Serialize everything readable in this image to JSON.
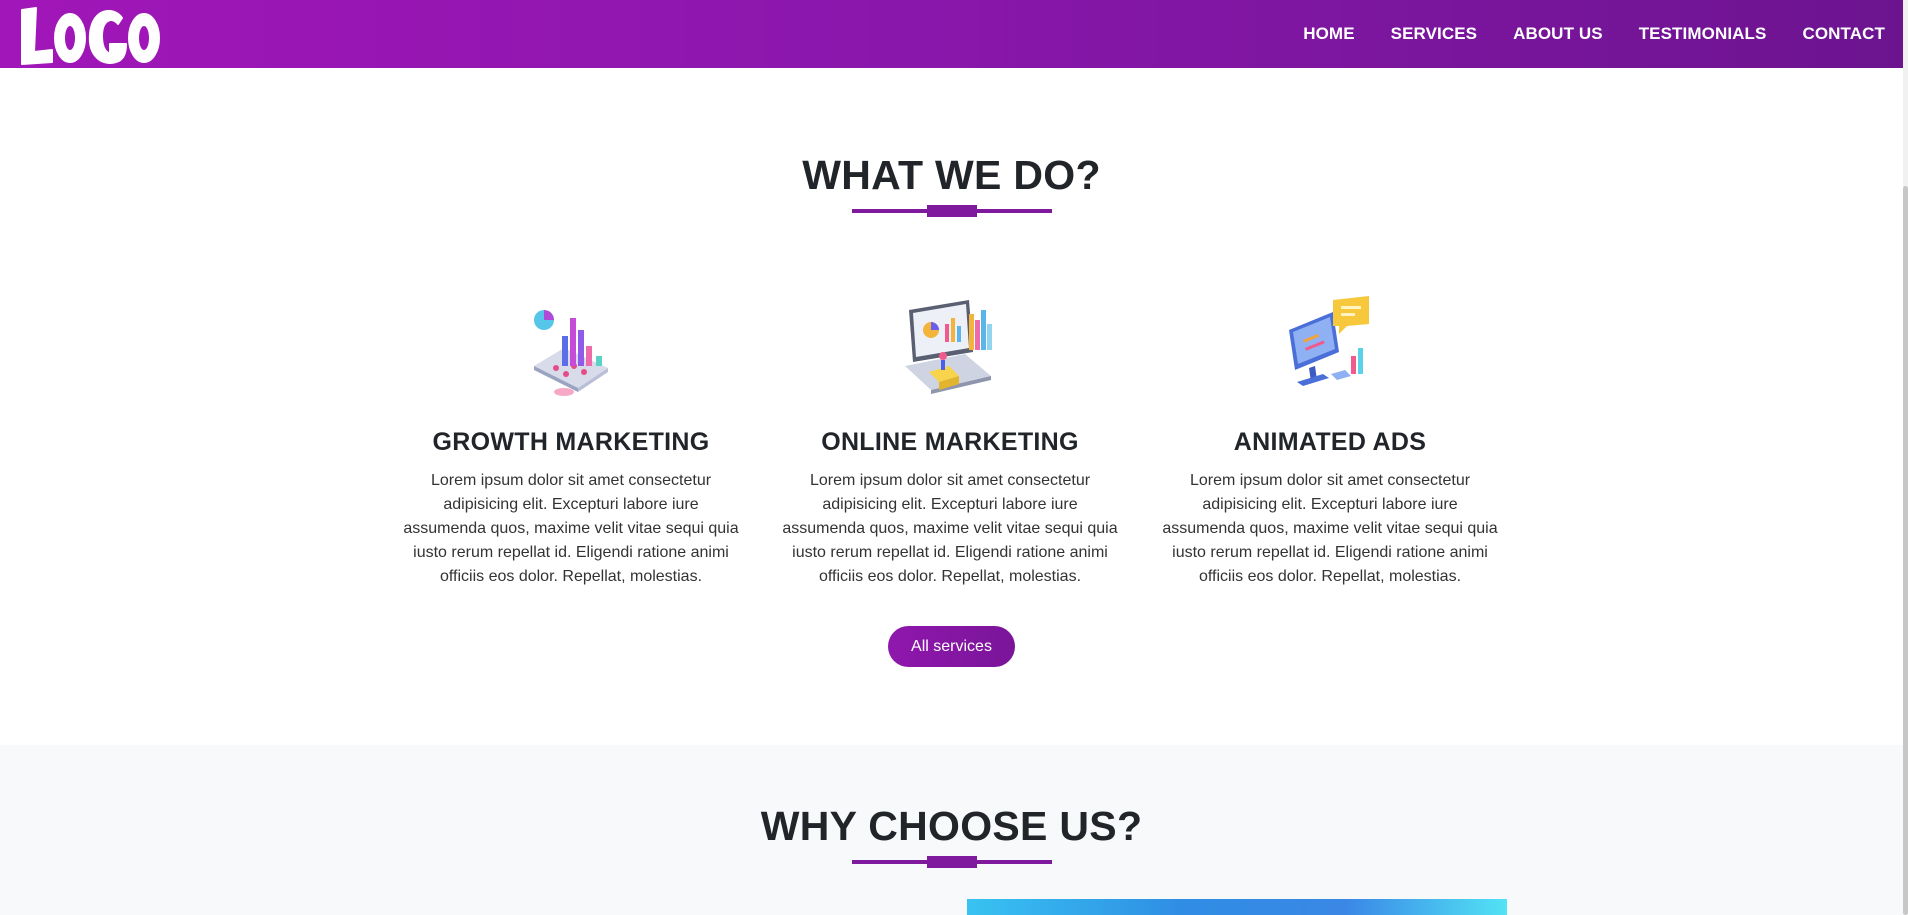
{
  "brand": {
    "logo_text": "LOGO"
  },
  "nav": {
    "items": [
      {
        "label": "HOME"
      },
      {
        "label": "SERVICES"
      },
      {
        "label": "ABOUT US"
      },
      {
        "label": "TESTIMONIALS"
      },
      {
        "label": "CONTACT"
      }
    ]
  },
  "services": {
    "heading": "WHAT WE DO?",
    "cards": [
      {
        "icon": "growth-chart-icon",
        "title": "GROWTH MARKETING",
        "text": "Lorem ipsum dolor sit amet consectetur adipisicing elit. Excepturi labore iure assumenda quos, maxime velit vitae sequi quia iusto rerum repellat id. Eligendi ratione animi officiis eos dolor. Repellat, molestias."
      },
      {
        "icon": "laptop-analytics-icon",
        "title": "ONLINE MARKETING",
        "text": "Lorem ipsum dolor sit amet consectetur adipisicing elit. Excepturi labore iure assumenda quos, maxime velit vitae sequi quia iusto rerum repellat id. Eligendi ratione animi officiis eos dolor. Repellat, molestias."
      },
      {
        "icon": "monitor-chat-icon",
        "title": "ANIMATED ADS",
        "text": "Lorem ipsum dolor sit amet consectetur adipisicing elit. Excepturi labore iure assumenda quos, maxime velit vitae sequi quia iusto rerum repellat id. Eligendi ratione animi officiis eos dolor. Repellat, molestias."
      }
    ],
    "button_label": "All services"
  },
  "why": {
    "heading": "WHY CHOOSE US?"
  },
  "colors": {
    "brand_purple": "#8f17ad",
    "brand_dark_purple": "#6c1490",
    "underline": "#7f1a9f",
    "section_alt_bg": "#f8f9fa"
  }
}
